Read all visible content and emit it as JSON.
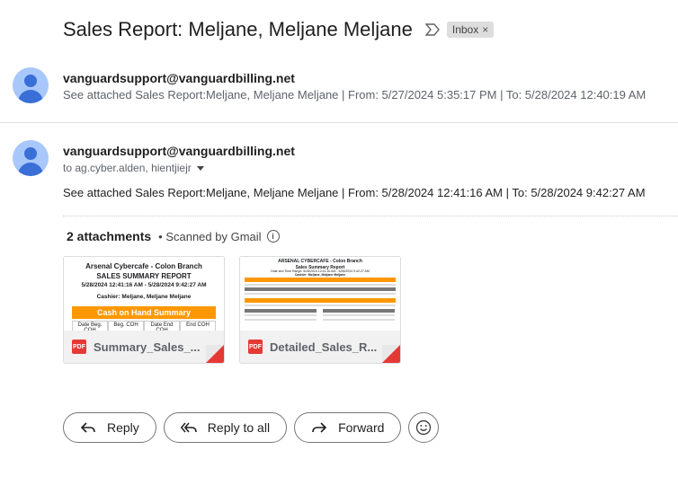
{
  "subject": "Sales Report: Meljane, Meljane Meljane",
  "label": "Inbox",
  "messages": [
    {
      "sender": "vanguardsupport@vanguardbilling.net",
      "snippet": "See attached Sales Report:Meljane, Meljane Meljane | From: 5/27/2024 5:35:17 PM | To: 5/28/2024 12:40:19 AM"
    },
    {
      "sender": "vanguardsupport@vanguardbilling.net",
      "to": "to ag.cyber.alden, hientjiejr",
      "body": "See attached Sales Report:Meljane, Meljane Meljane | From: 5/28/2024 12:41:16 AM | To: 5/28/2024 9:42:27 AM"
    }
  ],
  "attachments_header": {
    "count": "2 attachments",
    "scanned": "• Scanned by Gmail"
  },
  "attachments": [
    {
      "filename": "Summary_Sales_...",
      "type": "PDF",
      "preview": {
        "line1": "Arsenal Cybercafe - Colon Branch",
        "line2": "SALES SUMMARY REPORT",
        "line3": "5/28/2024 12:41:16 AM - 5/28/2024 9:42:27 AM",
        "line4": "Cashier: Meljane, Meljane Meljane",
        "section": "Cash on Hand Summary",
        "columns": [
          "Date Beg. COH",
          "Beg. COH",
          "Date End COH",
          "End COH"
        ]
      }
    },
    {
      "filename": "Detailed_Sales_R...",
      "type": "PDF",
      "preview": {
        "line1": "ARSENAL CYBERCAFE - Colon Branch",
        "line2": "Sales Summary Report",
        "line3": "Date and Time Range: 5/28/2024 12:41:16 AM - 5/28/2024 9:42:27 AM",
        "line4": "Cashier: Meljane, Meljane Meljane"
      }
    }
  ],
  "actions": {
    "reply": "Reply",
    "reply_all": "Reply to all",
    "forward": "Forward"
  }
}
